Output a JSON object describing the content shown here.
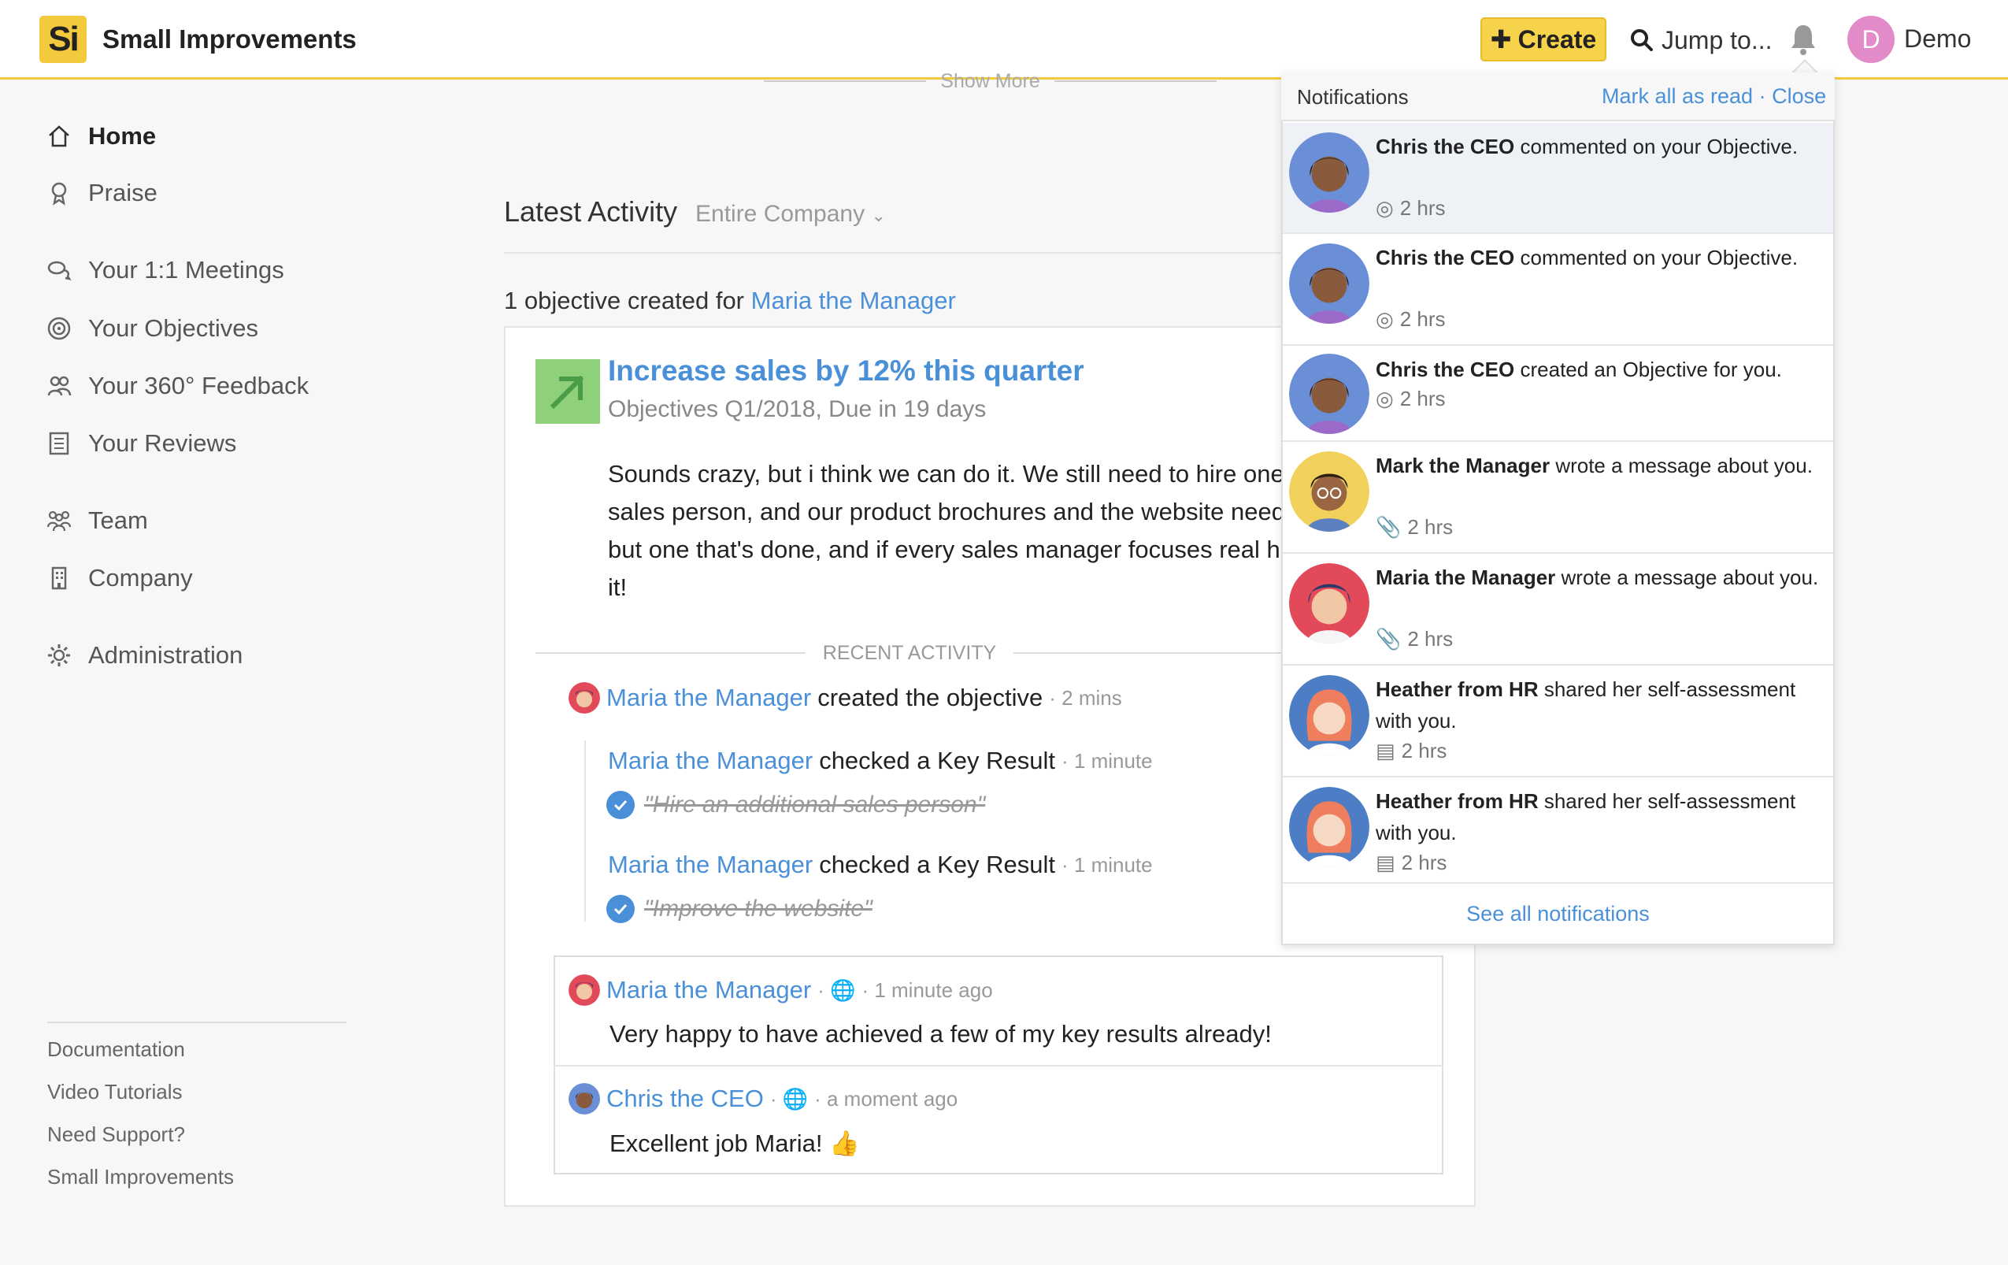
{
  "header": {
    "logo_text": "Si",
    "brand": "Small Improvements",
    "create_label": "Create",
    "jump_label": "Jump to...",
    "user_initial": "D",
    "user_name": "Demo"
  },
  "sidebar": {
    "items": [
      {
        "label": "Home",
        "icon": "home-icon"
      },
      {
        "label": "Praise",
        "icon": "praise-icon"
      },
      {
        "label": "Your 1:1 Meetings",
        "icon": "chat-icon"
      },
      {
        "label": "Your Objectives",
        "icon": "target-icon"
      },
      {
        "label": "Your 360° Feedback",
        "icon": "people-icon"
      },
      {
        "label": "Your Reviews",
        "icon": "document-icon"
      },
      {
        "label": "Team",
        "icon": "team-icon"
      },
      {
        "label": "Company",
        "icon": "building-icon"
      },
      {
        "label": "Administration",
        "icon": "gear-icon"
      }
    ],
    "footer_links": [
      "Documentation",
      "Video Tutorials",
      "Need Support?",
      "Small Improvements"
    ]
  },
  "main": {
    "show_more": "Show More",
    "latest_activity": "Latest Activity",
    "scope": "Entire Company",
    "objective_created_prefix": "1 objective created for",
    "objective_owner": "Maria the Manager",
    "objective": {
      "title": "Increase sales by 12% this quarter",
      "subtitle": "Objectives Q1/2018, Due in 19 days",
      "description": "Sounds crazy, but i think we can do it. We still need to hire one\nsales person, and our product brochures and the website need\nbut one that's done, and if every sales manager focuses real ha\nit!"
    },
    "recent_activity_label": "RECENT ACTIVITY",
    "activities": [
      {
        "actor": "Maria the Manager",
        "action": "created the objective",
        "time": "· 2 mins"
      },
      {
        "actor": "Maria the Manager",
        "action": "checked a Key Result",
        "time": "· 1 minute",
        "key_result": "\"Hire an additional sales person\""
      },
      {
        "actor": "Maria the Manager",
        "action": "checked a Key Result",
        "time": "· 1 minute",
        "key_result": "\"Improve the website\""
      }
    ],
    "comments": [
      {
        "author": "Maria the Manager",
        "time": "· 1 minute ago",
        "text": "Very happy to have achieved a few of my key results already!"
      },
      {
        "author": "Chris the CEO",
        "time": "· a moment ago",
        "text": "Excellent job Maria! 👍"
      }
    ]
  },
  "notifications": {
    "title": "Notifications",
    "mark_all_read": "Mark all as read",
    "close": "Close",
    "see_all": "See all notifications",
    "items": [
      {
        "actor": "Chris the CEO",
        "text": "commented on your Objective.",
        "time": "2 hrs",
        "meta_icon": "target-icon"
      },
      {
        "actor": "Chris the CEO",
        "text": "commented on your Objective.",
        "time": "2 hrs",
        "meta_icon": "target-icon"
      },
      {
        "actor": "Chris the CEO",
        "text": "created an Objective for you.",
        "time": "2 hrs",
        "meta_icon": "target-icon"
      },
      {
        "actor": "Mark the Manager",
        "text": "wrote a message about you.",
        "time": "2 hrs",
        "meta_icon": "paperclip-icon"
      },
      {
        "actor": "Maria the Manager",
        "text": "wrote a message about you.",
        "time": "2 hrs",
        "meta_icon": "paperclip-icon"
      },
      {
        "actor": "Heather from HR",
        "text": "shared her self-assessment with you.",
        "time": "2 hrs",
        "meta_icon": "document-icon"
      },
      {
        "actor": "Heather from HR",
        "text": "shared her self-assessment with you.",
        "time": "2 hrs",
        "meta_icon": "document-icon"
      }
    ]
  },
  "colors": {
    "brand_yellow": "#f3c93d",
    "link_blue": "#4a90d9",
    "objective_green": "#8fd17a"
  }
}
